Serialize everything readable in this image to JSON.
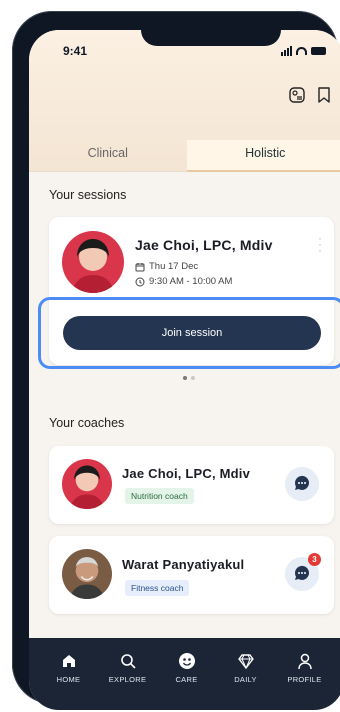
{
  "status_bar": {
    "time": "9:41"
  },
  "tabs": [
    {
      "label": "Clinical"
    },
    {
      "label": "Holistic"
    }
  ],
  "sessions": {
    "title": "Your sessions",
    "card": {
      "name": "Jae Choi, LPC, Mdiv",
      "date": "Thu 17 Dec",
      "time": "9:30 AM - 10:00 AM",
      "join_label": "Join session"
    }
  },
  "coaches": {
    "title": "Your coaches",
    "items": [
      {
        "name": "Jae Choi, LPC, Mdiv",
        "tag": "Nutrition coach",
        "unread": ""
      },
      {
        "name": "Warat Panyatiyakul",
        "tag": "Fitness coach",
        "unread": "3"
      }
    ]
  },
  "nav": [
    {
      "label": "HOME",
      "icon": "home-icon"
    },
    {
      "label": "EXPLORE",
      "icon": "search-icon"
    },
    {
      "label": "CARE",
      "icon": "care-icon"
    },
    {
      "label": "DAILY",
      "icon": "diamond-icon"
    },
    {
      "label": "PROFILE",
      "icon": "person-icon"
    }
  ],
  "colors": {
    "accent": "#243551",
    "highlight": "#4d8cf5",
    "nutrition_tag_bg": "#e4f4e8",
    "fitness_tag_bg": "#e6eefb"
  }
}
